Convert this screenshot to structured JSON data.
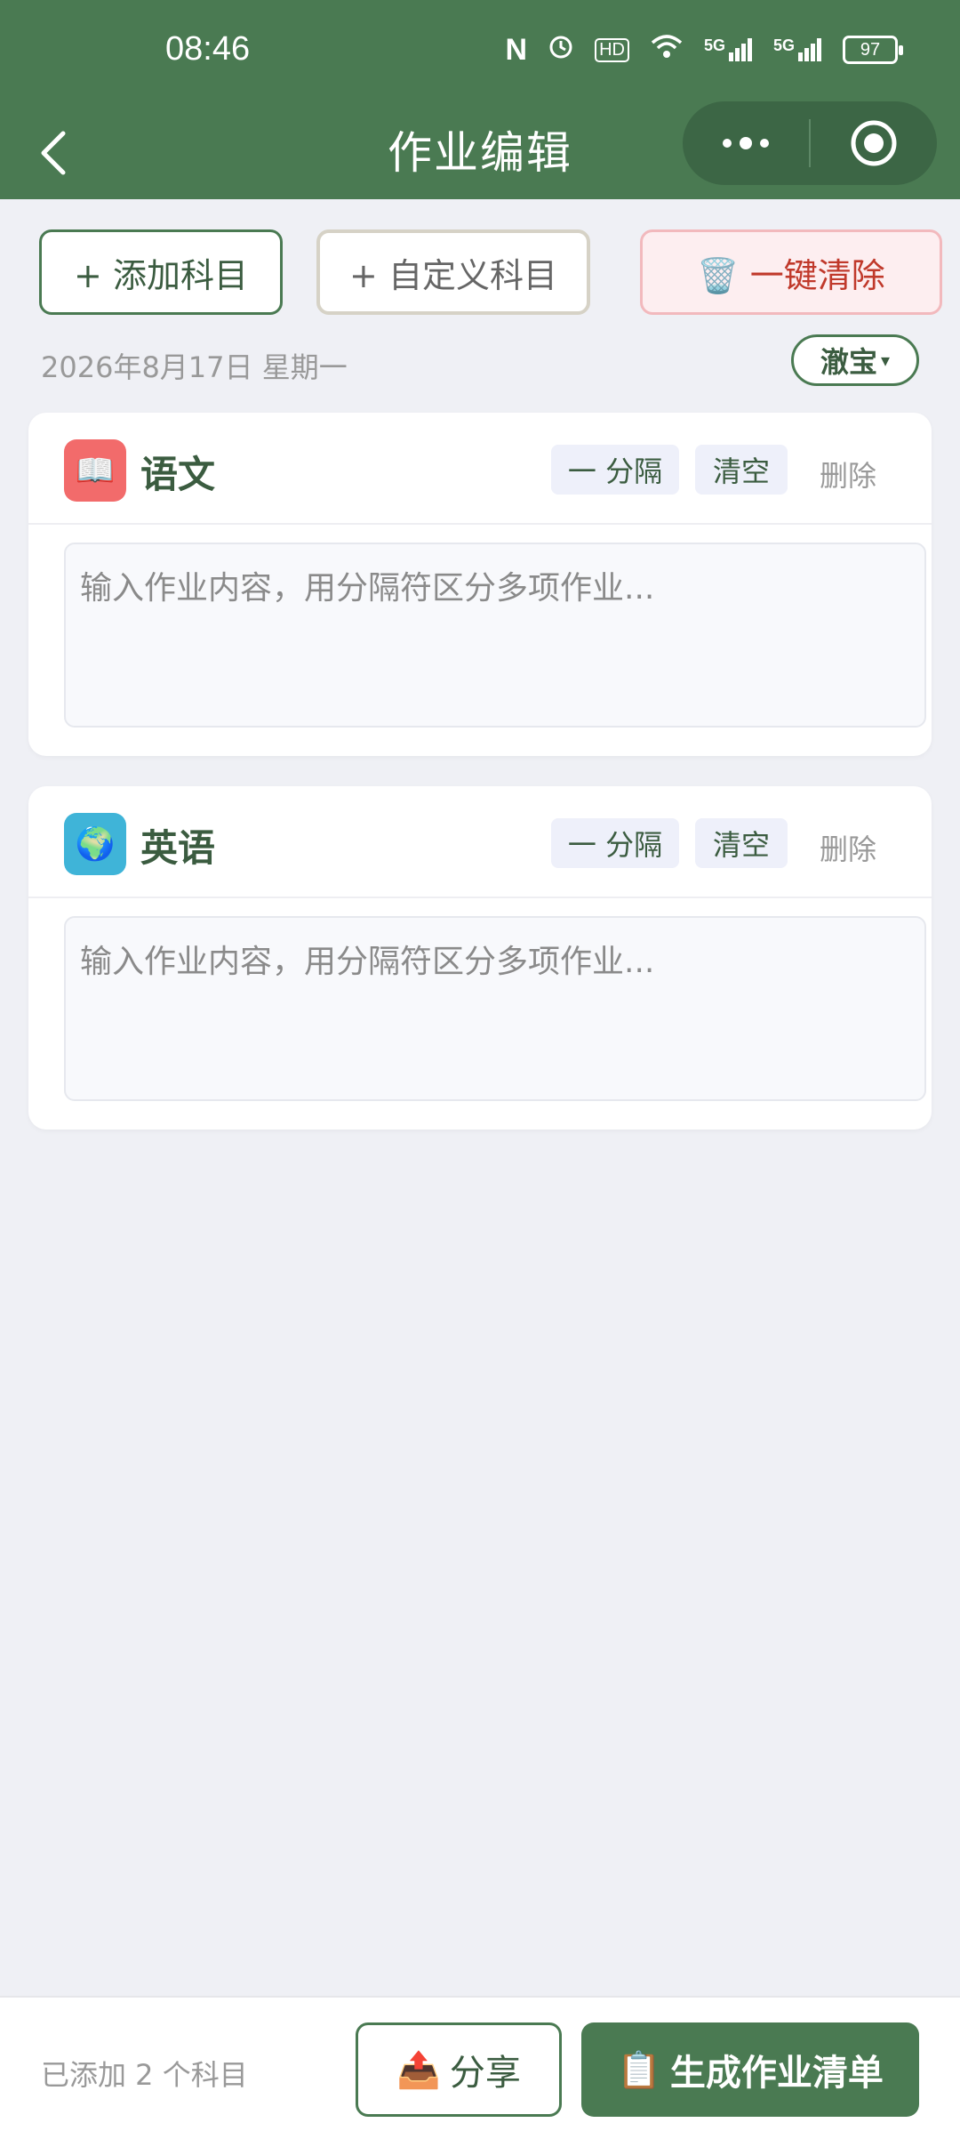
{
  "status_bar": {
    "time": "08:46",
    "icons": [
      "nfc-icon",
      "alarm-icon",
      "hd-icon",
      "wifi-icon",
      "signal-5g-icon",
      "signal-5g-icon"
    ],
    "hd_label": "HD",
    "signal_label": "5G",
    "battery": "97"
  },
  "nav": {
    "title": "作业编辑"
  },
  "toolbar": {
    "add_subject": "+ 添加科目",
    "custom_subject": "+ 自定义科目",
    "clear_all": "🗑️ 一键清除"
  },
  "date": "2026年8月17日 星期一",
  "pet": {
    "label": "澈宝",
    "caret": "▾"
  },
  "subjects": [
    {
      "name": "语文",
      "icon": "📖",
      "icon_bg": "#f26b6b",
      "separator_label": "一 分隔",
      "clear_label": "清空",
      "delete_label": "删除",
      "placeholder": "输入作业内容，用分隔符区分多项作业..."
    },
    {
      "name": "英语",
      "icon": "🌍",
      "icon_bg": "#3fb4d8",
      "separator_label": "一 分隔",
      "clear_label": "清空",
      "delete_label": "删除",
      "placeholder": "输入作业内容，用分隔符区分多项作业..."
    }
  ],
  "bottom": {
    "count_text": "已添加 2 个科目",
    "share_icon": "📤",
    "share_label": "分享",
    "generate_icon": "📋",
    "generate_label": "生成作业清单"
  },
  "colors": {
    "primary": "#4a7a52",
    "danger": "#c0392b",
    "background": "#eff0f5"
  }
}
